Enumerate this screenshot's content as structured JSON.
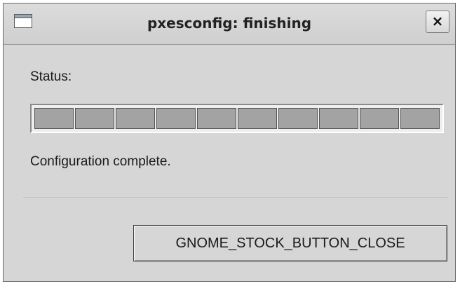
{
  "window": {
    "title": "pxesconfig: finishing",
    "close_symbol": "×",
    "icon": "window-icon"
  },
  "status": {
    "label": "Status:",
    "progress_percent": 100,
    "progress_blocks": 10,
    "message": "Configuration complete."
  },
  "actions": {
    "close_label": "GNOME_STOCK_BUTTON_CLOSE"
  }
}
